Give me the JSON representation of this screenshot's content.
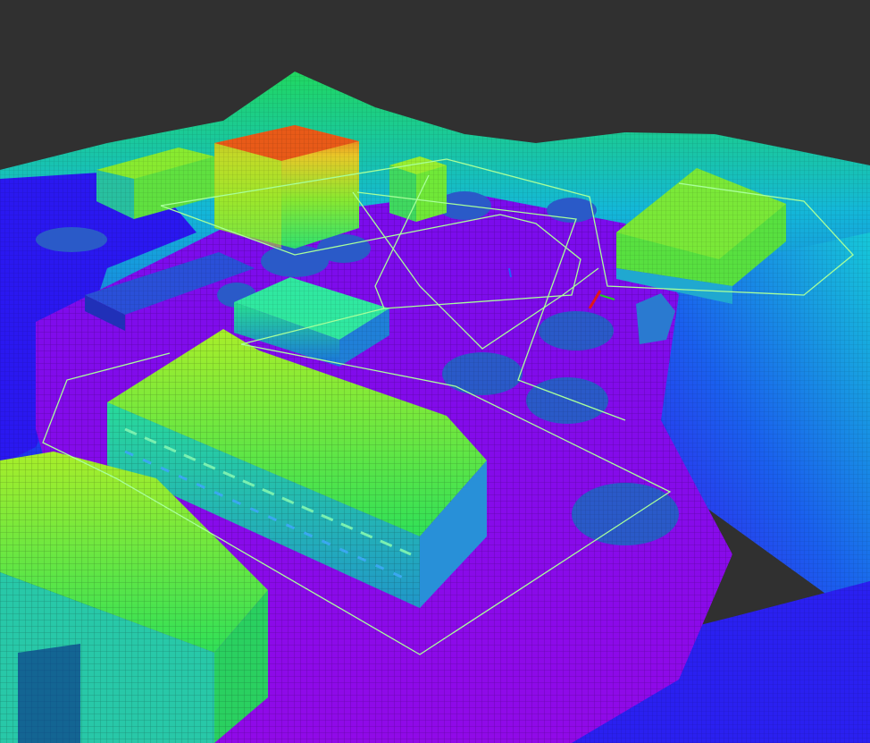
{
  "viewport": {
    "background": "#303030",
    "render_style": "voxel-occupancy-map",
    "colormap": "height-rainbow"
  },
  "palette": {
    "ground_low": "#8a08e8",
    "ground_mid": "#3a10f0",
    "terrain_blue": "#1f2ef2",
    "terrain_cyan": "#18c4d8",
    "building_green": "#5ff03a",
    "building_yellow": "#c8e82a",
    "building_orange": "#f06018",
    "tree_blue": "#2a62c8",
    "path_line": "#a8ff9a",
    "marker_red": "#e01818"
  },
  "overlays": {
    "flight_path": {
      "color": "#a8ff9a",
      "label": "flight-path"
    },
    "pose_marker": {
      "color": "#e01818",
      "label": "robot-pose"
    }
  }
}
